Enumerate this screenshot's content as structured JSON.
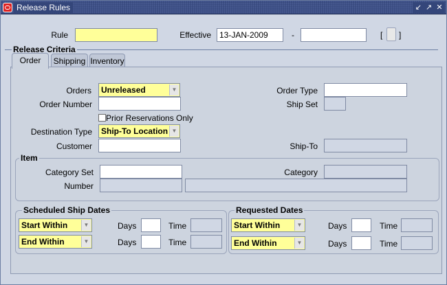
{
  "window": {
    "title": "Release Rules",
    "controls": [
      "↙",
      "↗",
      "✕"
    ]
  },
  "header": {
    "rule_label": "Rule",
    "rule_value": "",
    "effective_label": "Effective",
    "effective_from": "13-JAN-2009",
    "dash": "-",
    "effective_to": "",
    "bracket_open": "[",
    "bracket_close": "]"
  },
  "release_criteria": {
    "title": "Release Criteria",
    "tabs": [
      {
        "label": "Order"
      },
      {
        "label": "Shipping"
      },
      {
        "label": "Inventory"
      }
    ],
    "active_tab": "Order"
  },
  "order_tab": {
    "orders_label": "Orders",
    "orders_value": "Unreleased",
    "order_type_label": "Order Type",
    "order_type_value": "",
    "order_number_label": "Order Number",
    "order_number_value": "",
    "ship_set_label": "Ship Set",
    "ship_set_value": "",
    "prior_reservations_label": "Prior Reservations Only",
    "prior_reservations_checked": false,
    "destination_type_label": "Destination Type",
    "destination_type_value": "Ship-To Location",
    "customer_label": "Customer",
    "customer_value": "",
    "ship_to_label": "Ship-To",
    "ship_to_value": ""
  },
  "item": {
    "title": "Item",
    "category_set_label": "Category Set",
    "category_set_value": "",
    "category_label": "Category",
    "category_value": "",
    "number_label": "Number",
    "number_value": "",
    "description_value": ""
  },
  "scheduled_ship_dates": {
    "title": "Scheduled Ship Dates",
    "rows": [
      {
        "mode": "Start Within",
        "days_label": "Days",
        "days": "",
        "time_label": "Time",
        "time": ""
      },
      {
        "mode": "End Within",
        "days_label": "Days",
        "days": "",
        "time_label": "Time",
        "time": ""
      }
    ]
  },
  "requested_dates": {
    "title": "Requested Dates",
    "rows": [
      {
        "mode": "Start Within",
        "days_label": "Days",
        "days": "",
        "time_label": "Time",
        "time": ""
      },
      {
        "mode": "End Within",
        "days_label": "Days",
        "days": "",
        "time_label": "Time",
        "time": ""
      }
    ]
  },
  "colors": {
    "required": "#ffff99",
    "title_bar": "#34467a",
    "canvas": "#d0d7e4"
  }
}
